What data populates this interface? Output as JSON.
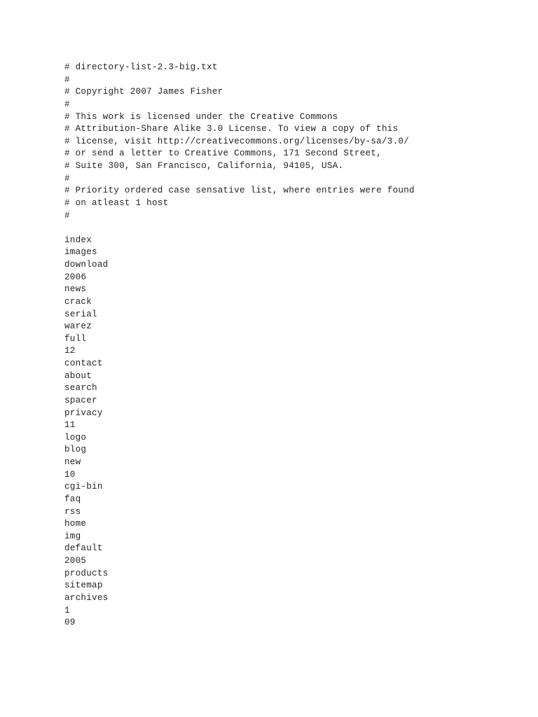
{
  "document": {
    "filename": "directory-list-2.3-big.txt",
    "type": "plain-text",
    "background_color": "#ffffff",
    "text_color": "#231f20"
  },
  "header_comments": [
    "# directory-list-2.3-big.txt",
    "#",
    "# Copyright 2007 James Fisher",
    "#",
    "# This work is licensed under the Creative Commons",
    "# Attribution-Share Alike 3.0 License. To view a copy of this",
    "# license, visit http://creativecommons.org/licenses/by-sa/3.0/",
    "# or send a letter to Creative Commons, 171 Second Street,",
    "# Suite 300, San Francisco, California, 94105, USA.",
    "#",
    "# Priority ordered case sensative list, where entries were found",
    "# on atleast 1 host",
    "#"
  ],
  "separator": "",
  "entries": [
    "index",
    "images",
    "download",
    "2006",
    "news",
    "crack",
    "serial",
    "warez",
    "full",
    "12",
    "contact",
    "about",
    "search",
    "spacer",
    "privacy",
    "11",
    "logo",
    "blog",
    "new",
    "10",
    "cgi-bin",
    "faq",
    "rss",
    "home",
    "img",
    "default",
    "2005",
    "products",
    "sitemap",
    "archives",
    "1",
    "09"
  ]
}
